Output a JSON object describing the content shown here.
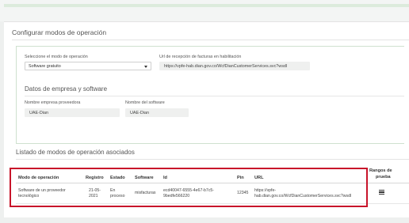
{
  "operation": {
    "section_title": "Configurar modos de operación",
    "mode_label": "Seleccione el modo de operación",
    "mode_value": "Software gratuito",
    "url_label": "Url de recepción de facturas en habilitación",
    "url_value": "https://vpfe-hab.dian.gov.co/WcfDianCustomerServices.svc?wsdl"
  },
  "company": {
    "title": "Datos de empresa y software",
    "provider_label": "Nombre empresa proveedora",
    "provider_value": "UAE-Dian",
    "software_label": "Nombre del software",
    "software_value": "UAE-Dian"
  },
  "list": {
    "title": "Listado de modos de operación asociados",
    "headers": {
      "mode": "Modo de operación",
      "registro": "Registro",
      "estado": "Estado",
      "software": "Software",
      "id": "Id",
      "pin": "Pin",
      "url": "URL",
      "rangos": "Rangos de",
      "prueba": "prueba"
    },
    "rows": [
      {
        "mode_line1": "Software de un proveedor",
        "mode_line2": "tecnológico",
        "registro_line1": "21-05-",
        "registro_line2": "2021",
        "estado_line1": "En",
        "estado_line2": "proceso",
        "software": "misfacturas",
        "id_line1": "ecd40047-6555-4e67-b7c5-",
        "id_line2": "9bedfe566220",
        "pin": "12345",
        "url_line1": "https://vpfe-",
        "url_line2": "hab.dian.gov.co/WcfDianCustomerServices.svc?wsdl",
        "rangos_icon": "list-icon"
      }
    ]
  },
  "colors": {
    "highlight_border": "#c8142a",
    "panel_border": "#cfe1cf",
    "field_bg": "#eff0ef"
  }
}
